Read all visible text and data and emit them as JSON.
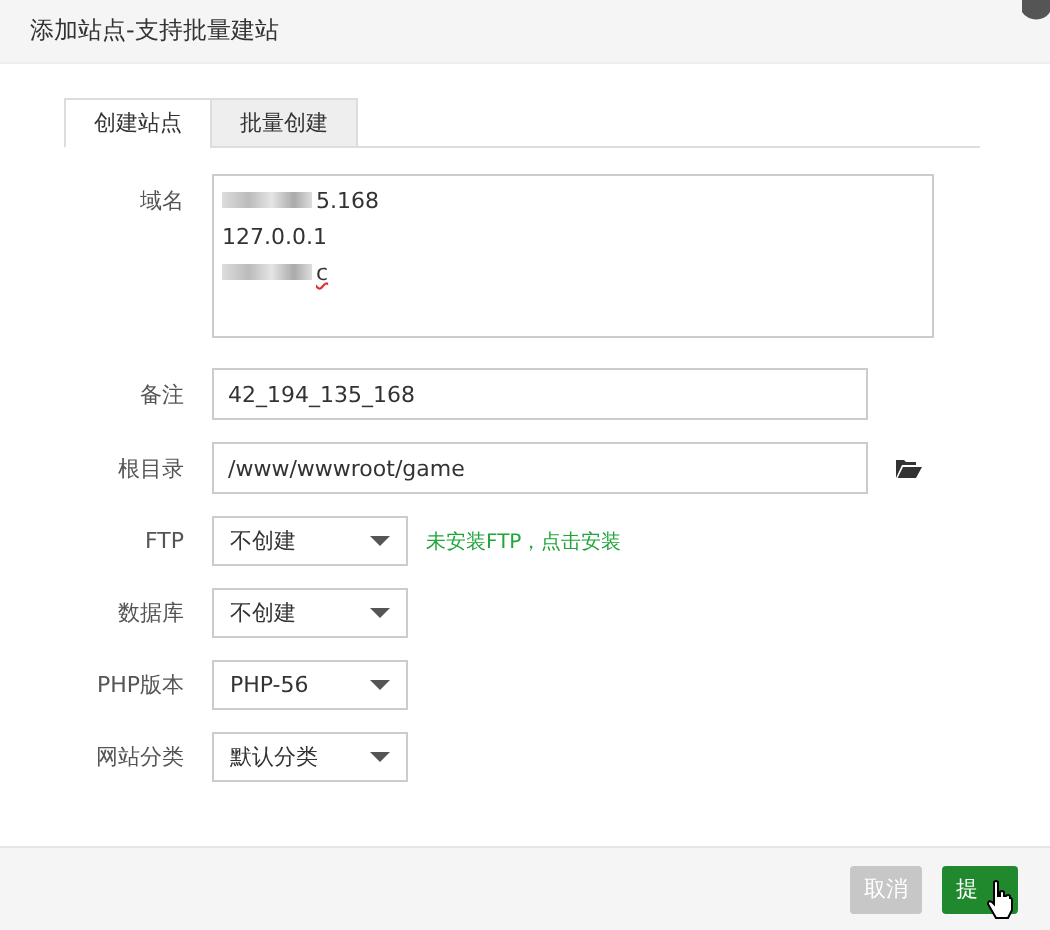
{
  "window": {
    "title": "添加站点-支持批量建站"
  },
  "tabs": [
    {
      "label": "创建站点",
      "selected": true
    },
    {
      "label": "批量创建",
      "selected": false
    }
  ],
  "domain": {
    "label": "域名",
    "lines": [
      {
        "text": "5.168",
        "redacted": true,
        "misspelled": false
      },
      {
        "text": "127.0.0.1",
        "redacted": false,
        "misspelled": false
      },
      {
        "text": "c",
        "redacted": true,
        "misspelled": true
      }
    ]
  },
  "note": {
    "label": "备注",
    "value": "42_194_135_168"
  },
  "root": {
    "label": "根目录",
    "value": "/www/wwwroot/game"
  },
  "selects": [
    {
      "label": "FTP",
      "value": "不创建",
      "hint": "未安装FTP，点击安装"
    },
    {
      "label": "数据库",
      "value": "不创建"
    },
    {
      "label": "PHP版本",
      "value": "PHP-56"
    },
    {
      "label": "网站分类",
      "value": "默认分类"
    }
  ],
  "buttons": [
    {
      "label": "取消",
      "kind": "cancel"
    },
    {
      "label": "提",
      "kind": "submit"
    }
  ]
}
